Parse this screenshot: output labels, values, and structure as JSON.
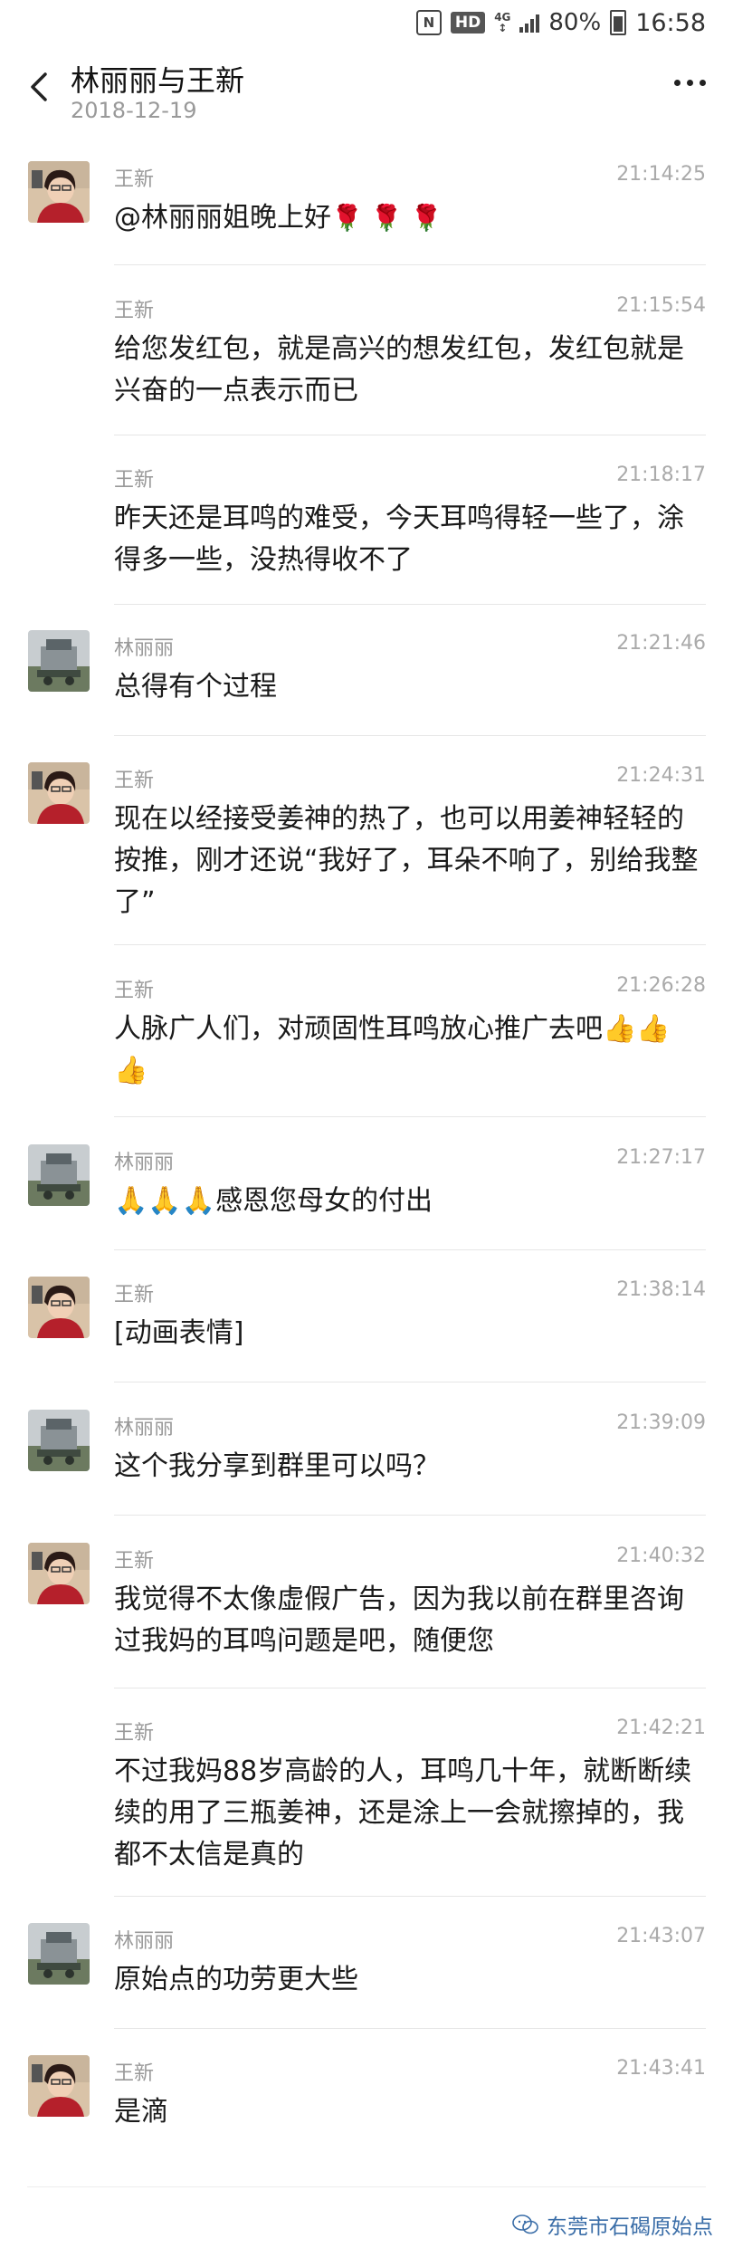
{
  "status": {
    "signal": "4G",
    "battery": "80%",
    "time": "16:58",
    "hd": "HD",
    "nfc": "N"
  },
  "header": {
    "title": "林丽丽与王新",
    "date": "2018-12-19"
  },
  "messages": [
    {
      "name": "王新",
      "time": "21:14:25",
      "text": "@林丽丽姐晚上好",
      "extra": "🌹 🌹 🌹"
    },
    {
      "name": "王新",
      "time": "21:15:54",
      "text": "给您发红包，就是高兴的想发红包，发红包就是兴奋的一点表示而已"
    },
    {
      "name": "王新",
      "time": "21:18:17",
      "text": "昨天还是耳鸣的难受，今天耳鸣得轻一些了，涂得多一些，没热得收不了"
    },
    {
      "name": "林丽丽",
      "time": "21:21:46",
      "text": "总得有个过程"
    },
    {
      "name": "王新",
      "time": "21:24:31",
      "text": "现在以经接受姜神的热了，也可以用姜神轻轻的按推，刚才还说“我好了，耳朵不响了，别给我整了”"
    },
    {
      "name": "王新",
      "time": "21:26:28",
      "text": "人脉广人们，对顽固性耳鸣放心推广去吧",
      "extra": "👍👍👍"
    },
    {
      "name": "林丽丽",
      "time": "21:27:17",
      "prefix": "🙏🙏🙏",
      "text": "感恩您母女的付出"
    },
    {
      "name": "王新",
      "time": "21:38:14",
      "text": "[动画表情]"
    },
    {
      "name": "林丽丽",
      "time": "21:39:09",
      "text": "这个我分享到群里可以吗？"
    },
    {
      "name": "王新",
      "time": "21:40:32",
      "text": "我觉得不太像虚假广告，因为我以前在群里咨询过我妈的耳鸣问题是吧，随便您"
    },
    {
      "name": "王新",
      "time": "21:42:21",
      "text": "不过我妈88岁高龄的人，耳鸣几十年，就断断续续的用了三瓶姜神，还是涂上一会就擦掉的，我都不太信是真的"
    },
    {
      "name": "林丽丽",
      "time": "21:43:07",
      "text": "原始点的功劳更大些"
    },
    {
      "name": "王新",
      "time": "21:43:41",
      "text": "是滴"
    }
  ],
  "watermark": "东莞市石碣原始点"
}
